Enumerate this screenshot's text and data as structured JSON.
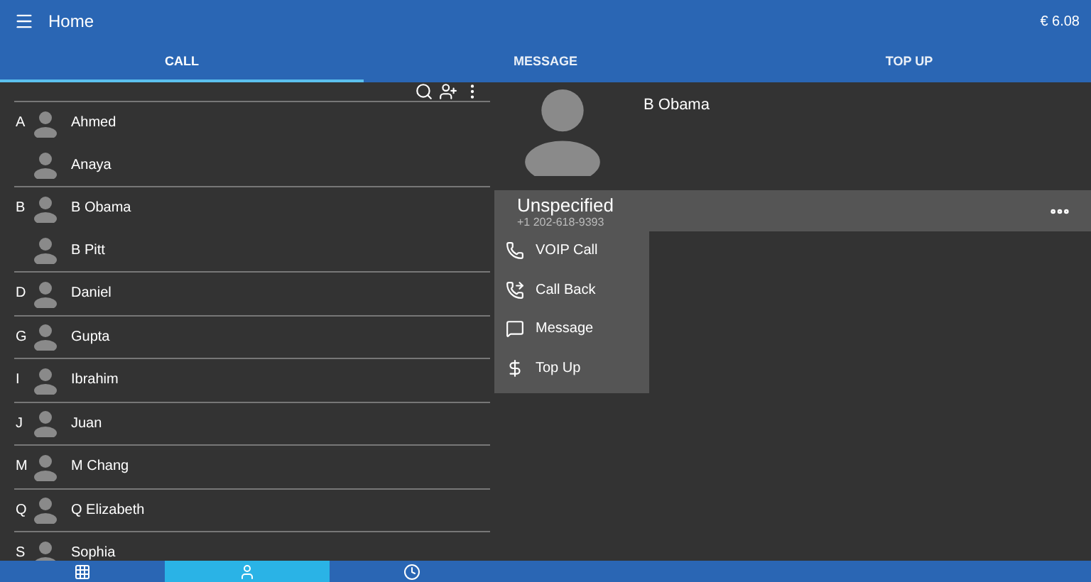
{
  "header": {
    "title": "Home",
    "balance": "€ 6.08"
  },
  "tabs": [
    {
      "label": "CALL",
      "selected": true
    },
    {
      "label": "MESSAGE",
      "selected": false
    },
    {
      "label": "TOP UP",
      "selected": false
    }
  ],
  "contact_groups": [
    {
      "letter": "A",
      "contacts": [
        "Ahmed",
        "Anaya"
      ]
    },
    {
      "letter": "B",
      "contacts": [
        "B Obama",
        "B Pitt"
      ]
    },
    {
      "letter": "D",
      "contacts": [
        "Daniel"
      ]
    },
    {
      "letter": "G",
      "contacts": [
        "Gupta"
      ]
    },
    {
      "letter": "I",
      "contacts": [
        "Ibrahim"
      ]
    },
    {
      "letter": "J",
      "contacts": [
        "Juan"
      ]
    },
    {
      "letter": "M",
      "contacts": [
        "M Chang"
      ]
    },
    {
      "letter": "Q",
      "contacts": [
        "Q Elizabeth"
      ]
    },
    {
      "letter": "S",
      "contacts": [
        "Sophia"
      ]
    }
  ],
  "detail": {
    "name": "B Obama",
    "number_label": "Unspecified",
    "number": "+1 202-618-9393",
    "actions": [
      {
        "kind": "call",
        "label": "VOIP Call"
      },
      {
        "kind": "callback",
        "label": "Call Back"
      },
      {
        "kind": "message",
        "label": "Message"
      },
      {
        "kind": "topup",
        "label": "Top Up"
      }
    ]
  },
  "bottom_nav": [
    {
      "kind": "dialpad",
      "selected": false
    },
    {
      "kind": "contacts",
      "selected": true
    },
    {
      "kind": "history",
      "selected": false
    }
  ]
}
